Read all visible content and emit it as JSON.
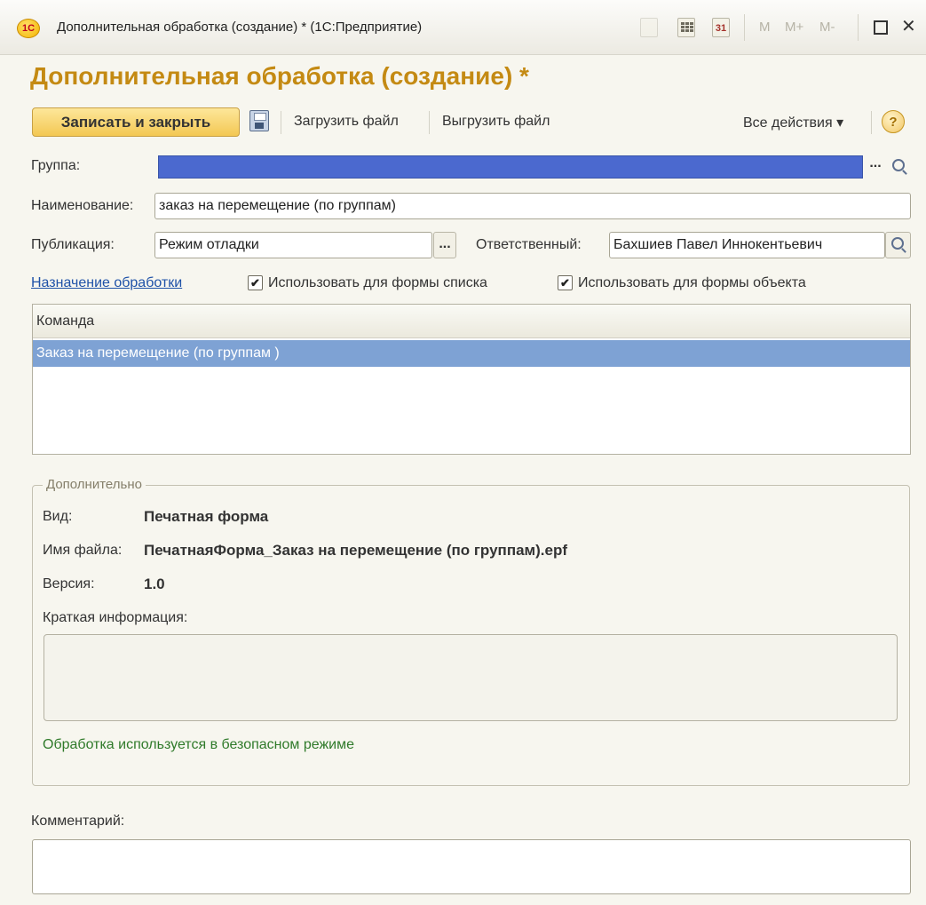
{
  "window": {
    "title": "Дополнительная обработка (создание) * (1С:Предприятие)",
    "logo_text": "1С",
    "calendar_day": "31",
    "mem_buttons": [
      "M",
      "M+",
      "M-"
    ],
    "close_glyph": "✕"
  },
  "form": {
    "title": "Дополнительная обработка (создание) *"
  },
  "toolbar": {
    "save_close_label": "Записать и закрыть",
    "load_file_label": "Загрузить файл",
    "unload_file_label": "Выгрузить файл",
    "all_actions_label": "Все действия ▾",
    "help_glyph": "?"
  },
  "fields": {
    "group_label": "Группа:",
    "group_value": "",
    "name_label": "Наименование:",
    "name_value": "заказ на перемещение (по группам)",
    "publication_label": "Публикация:",
    "publication_value": "Режим отладки",
    "responsible_label": "Ответственный:",
    "responsible_value": "Бахшиев Павел Иннокентьевич",
    "ellipsis": "..."
  },
  "assignment": {
    "link_label": "Назначение обработки",
    "use_list_form_label": "Использовать для формы списка",
    "use_list_form_checked": true,
    "use_object_form_label": "Использовать для формы объекта",
    "use_object_form_checked": true,
    "check_glyph": "✔"
  },
  "commands_table": {
    "header": "Команда",
    "rows": [
      "Заказ на перемещение (по группам )"
    ]
  },
  "additional": {
    "legend": "Дополнительно",
    "kind_label": "Вид:",
    "kind_value": "Печатная форма",
    "file_label": "Имя файла:",
    "file_value": "ПечатнаяФорма_Заказ на перемещение (по группам).epf",
    "version_label": "Версия:",
    "version_value": "1.0",
    "brief_info_label": "Краткая информация:",
    "brief_info_value": "",
    "safe_mode_note": "Обработка используется в безопасном режиме"
  },
  "comment": {
    "label": "Комментарий:",
    "value": ""
  },
  "colors": {
    "title_gold": "#c48a13",
    "selection_blue": "#7ea2d4",
    "group_field_blue": "#4b69cf",
    "safe_note_green": "#2f7a2a",
    "link_blue": "#1f52a8"
  }
}
